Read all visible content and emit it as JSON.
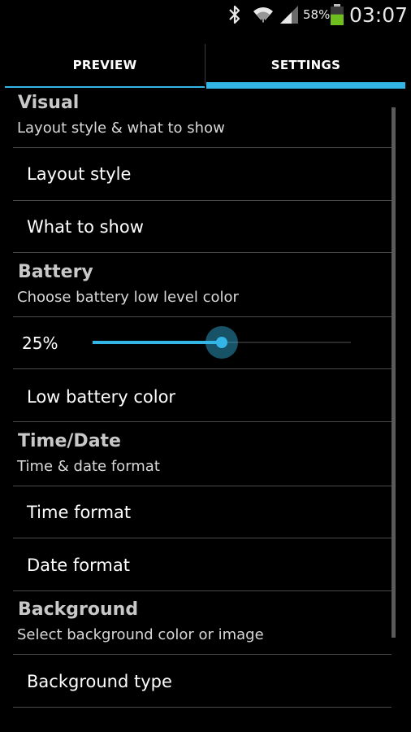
{
  "status_bar": {
    "icons": [
      "bluetooth-icon",
      "wifi-icon",
      "signal-icon",
      "battery-icon"
    ],
    "battery_percent": "58%",
    "time": "03:07",
    "battery_level": 0.58
  },
  "tabs": [
    {
      "label": "PREVIEW",
      "selected": false
    },
    {
      "label": "SETTINGS",
      "selected": true
    }
  ],
  "colors": {
    "accent": "#33b5e5",
    "background": "#000000",
    "battery_fill": "#6fbf1f"
  },
  "settings": {
    "visual": {
      "title": "Visual",
      "summary": "Layout style & what to show",
      "items": [
        "Layout style",
        "What to show"
      ]
    },
    "battery": {
      "title": "Battery",
      "summary": "Choose battery low level color",
      "slider_value": "25%",
      "slider_fraction": 0.5,
      "items": [
        "Low battery color"
      ]
    },
    "time_date": {
      "title": "Time/Date",
      "summary": "Time & date format",
      "items": [
        "Time format",
        "Date format"
      ]
    },
    "background": {
      "title": "Background",
      "summary": "Select background color or image",
      "items": [
        "Background type"
      ]
    }
  }
}
